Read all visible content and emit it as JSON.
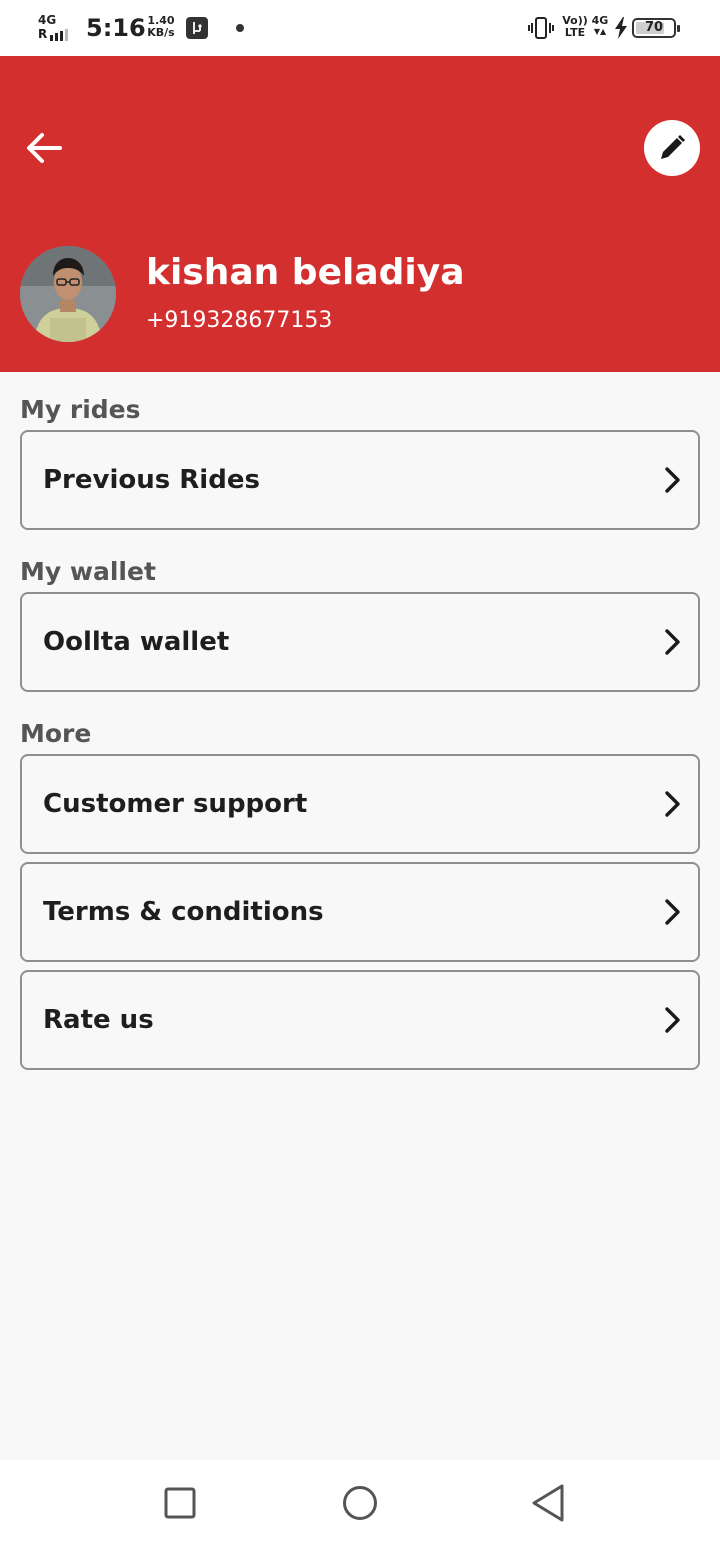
{
  "status_bar": {
    "network_type": "4G",
    "signal_prefix": "R",
    "time": "5:16",
    "speed_value": "1.40",
    "speed_unit": "KB/s",
    "volte_top": "Vo))",
    "volte_bottom": "LTE",
    "data_type": "4G",
    "battery_level": "70"
  },
  "header": {
    "name": "kishan beladiya",
    "phone": "+919328677153",
    "accent_color": "#d32f2f"
  },
  "sections": {
    "rides_title": "My rides",
    "wallet_title": "My wallet",
    "more_title": "More"
  },
  "menu": {
    "previous_rides": "Previous Rides",
    "wallet": "Oollta wallet",
    "customer_support": "Customer support",
    "terms": "Terms & conditions",
    "rate_us": "Rate us"
  },
  "icons": {
    "back": "arrow-left-icon",
    "edit": "pencil-icon",
    "chevron": "chevron-right-icon",
    "nav_recents": "square-icon",
    "nav_home": "circle-icon",
    "nav_back": "triangle-back-icon"
  }
}
